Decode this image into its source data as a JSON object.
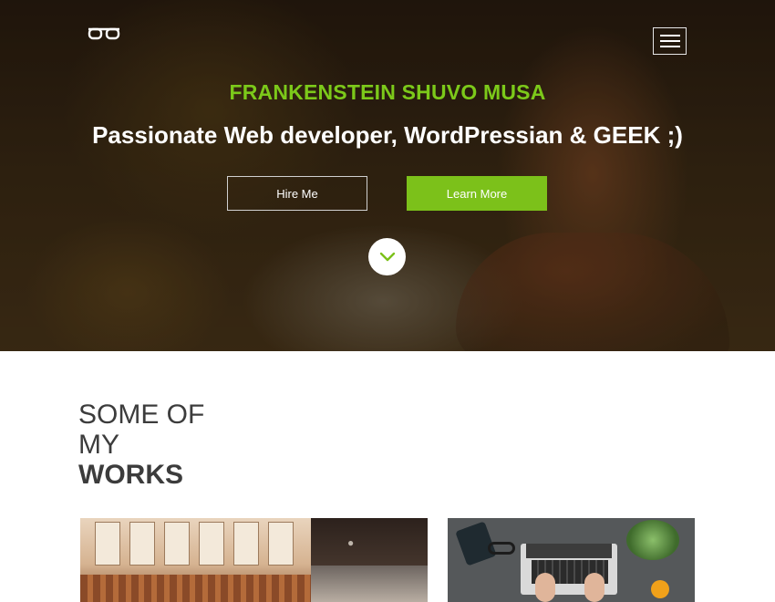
{
  "hero": {
    "name": "FRANKENSTEIN SHUVO MUSA",
    "tagline": "Passionate Web developer, WordPressian & GEEK ;)",
    "hire_label": "Hire Me",
    "learn_label": "Learn More",
    "logo_icon": "glasses-icon",
    "menu_icon": "hamburger-menu-icon",
    "scroll_icon": "chevron-down-icon"
  },
  "works": {
    "title_line1": "SOME OF",
    "title_line2": "MY",
    "title_line3": "WORKS"
  },
  "colors": {
    "accent": "#7cc11a",
    "heading": "#3c3c3c"
  }
}
